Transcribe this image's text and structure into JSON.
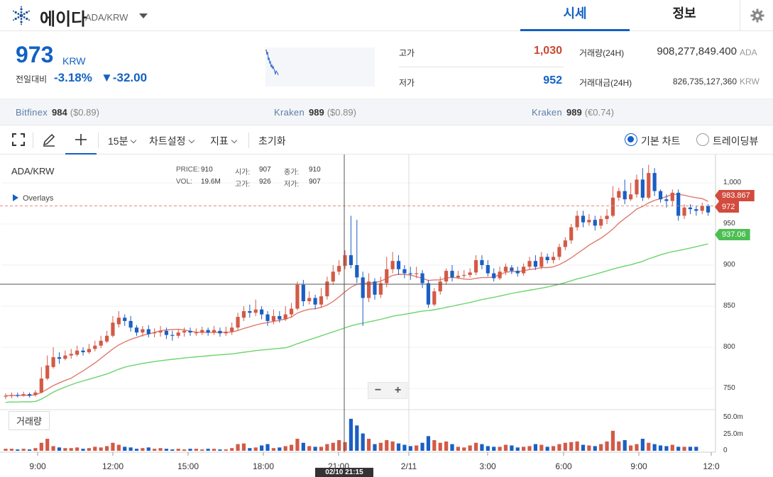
{
  "header": {
    "coin_name": "에이다",
    "coin_pair": "ADA/KRW",
    "tab_market": "시세",
    "tab_info": "정보"
  },
  "price": {
    "current": "973",
    "unit": "KRW",
    "change_label": "전일대비",
    "change_pct": "-3.18%",
    "change_abs": "▼-32.00"
  },
  "stats": {
    "high_label": "고가",
    "high_value": "1,030",
    "low_label": "저가",
    "low_value": "952",
    "volume_label": "거래량(24H)",
    "volume_value": "908,277,849.400",
    "volume_unit": "ADA",
    "amount_label": "거래대금(24H)",
    "amount_value": "826,735,127,360",
    "amount_unit": "KRW"
  },
  "exchanges": [
    {
      "name": "Bitfinex",
      "price": "984",
      "fx": "($0.89)"
    },
    {
      "name": "Kraken",
      "price": "989",
      "fx": "($0.89)"
    },
    {
      "name": "Kraken",
      "price": "989",
      "fx": "(€0.74)"
    }
  ],
  "toolbar": {
    "interval": "15분",
    "chart_settings": "차트설정",
    "indicators": "지표",
    "reset": "초기화",
    "basic_chart": "기본 차트",
    "tradingview": "트레이딩뷰"
  },
  "chart_overlay": {
    "pair": "ADA/KRW",
    "price_k": "PRICE:",
    "price_v": "910",
    "open_k": "시가:",
    "open_v": "907",
    "close_k": "종가:",
    "close_v": "910",
    "vol_k": "VOL:",
    "vol_v": "19.6M",
    "high_k": "고가:",
    "high_v": "926",
    "low_k": "저가:",
    "low_v": "907",
    "overlays": "Overlays",
    "zoom_out": "−",
    "zoom_in": "+",
    "volume_tab": "거래량",
    "crosshair_time": "02/10 21:15"
  },
  "colors": {
    "up": "#d35a46",
    "down": "#1a5fc4",
    "ma_short": "#e07a6c",
    "ma_long": "#6cd46c",
    "accent": "#1261c4"
  },
  "chart_data": {
    "type": "candlestick",
    "y_ticks": [
      "1,000",
      "950",
      "900",
      "850",
      "800",
      "750"
    ],
    "y_tick_values": [
      1000,
      950,
      900,
      850,
      800,
      750
    ],
    "vol_ticks": [
      "50.0m",
      "25.0m",
      "0"
    ],
    "vol_tick_values": [
      50,
      25,
      0
    ],
    "x_ticks": [
      "9:00",
      "12:00",
      "15:00",
      "18:00",
      "21:00",
      "2/11",
      "3:00",
      "6:00",
      "9:00",
      "12:0"
    ],
    "price_tags": [
      {
        "label": "983.867",
        "value": 983.867,
        "color": "#d24b3e"
      },
      {
        "label": "972",
        "value": 972,
        "color": "#d24b3e"
      },
      {
        "label": "937.06",
        "value": 937.06,
        "color": "#4cbf52"
      }
    ],
    "ylim": [
      730,
      1030
    ],
    "candles": [
      [
        740,
        741,
        737,
        744
      ],
      [
        741,
        742,
        738,
        745
      ],
      [
        742,
        741,
        739,
        745
      ],
      [
        741,
        743,
        740,
        746
      ],
      [
        743,
        741,
        739,
        745
      ],
      [
        742,
        745,
        740,
        748
      ],
      [
        745,
        762,
        744,
        776
      ],
      [
        762,
        778,
        760,
        790
      ],
      [
        776,
        788,
        774,
        800
      ],
      [
        788,
        786,
        780,
        794
      ],
      [
        786,
        790,
        784,
        796
      ],
      [
        790,
        792,
        786,
        798
      ],
      [
        791,
        796,
        789,
        802
      ],
      [
        796,
        794,
        790,
        800
      ],
      [
        794,
        798,
        792,
        804
      ],
      [
        798,
        802,
        795,
        808
      ],
      [
        802,
        808,
        799,
        814
      ],
      [
        807,
        814,
        805,
        820
      ],
      [
        814,
        830,
        812,
        838
      ],
      [
        828,
        836,
        824,
        844
      ],
      [
        836,
        832,
        826,
        840
      ],
      [
        832,
        824,
        819,
        838
      ],
      [
        824,
        818,
        814,
        827
      ],
      [
        818,
        822,
        813,
        826
      ],
      [
        822,
        816,
        812,
        827
      ],
      [
        817,
        818,
        812,
        823
      ],
      [
        818,
        820,
        813,
        826
      ],
      [
        820,
        815,
        810,
        824
      ],
      [
        815,
        814,
        808,
        820
      ],
      [
        814,
        818,
        811,
        822
      ],
      [
        818,
        820,
        813,
        824
      ],
      [
        820,
        818,
        814,
        824
      ],
      [
        818,
        818,
        814,
        823
      ],
      [
        818,
        821,
        815,
        825
      ],
      [
        821,
        818,
        814,
        824
      ],
      [
        818,
        821,
        815,
        826
      ],
      [
        820,
        817,
        813,
        824
      ],
      [
        817,
        819,
        814,
        825
      ],
      [
        819,
        824,
        815,
        830
      ],
      [
        824,
        837,
        821,
        842
      ],
      [
        836,
        844,
        832,
        850
      ],
      [
        844,
        842,
        836,
        852
      ],
      [
        842,
        846,
        838,
        858
      ],
      [
        846,
        840,
        834,
        850
      ],
      [
        840,
        832,
        826,
        844
      ],
      [
        832,
        838,
        828,
        846
      ],
      [
        838,
        834,
        830,
        844
      ],
      [
        834,
        840,
        832,
        850
      ],
      [
        840,
        847,
        836,
        854
      ],
      [
        847,
        876,
        845,
        880
      ],
      [
        876,
        856,
        850,
        882
      ],
      [
        856,
        860,
        852,
        868
      ],
      [
        860,
        852,
        846,
        864
      ],
      [
        852,
        862,
        848,
        872
      ],
      [
        862,
        880,
        858,
        886
      ],
      [
        880,
        892,
        876,
        900
      ],
      [
        892,
        899,
        888,
        906
      ],
      [
        899,
        912,
        895,
        918
      ],
      [
        912,
        900,
        896,
        960
      ],
      [
        900,
        885,
        878,
        955
      ],
      [
        885,
        860,
        826,
        892
      ],
      [
        860,
        880,
        855,
        890
      ],
      [
        880,
        864,
        858,
        884
      ],
      [
        864,
        878,
        860,
        886
      ],
      [
        878,
        895,
        873,
        910
      ],
      [
        895,
        905,
        890,
        916
      ],
      [
        905,
        895,
        888,
        912
      ],
      [
        895,
        890,
        884,
        900
      ],
      [
        890,
        889,
        882,
        898
      ],
      [
        889,
        890,
        884,
        898
      ],
      [
        890,
        878,
        872,
        894
      ],
      [
        878,
        852,
        848,
        882
      ],
      [
        852,
        868,
        850,
        872
      ],
      [
        868,
        880,
        864,
        886
      ],
      [
        880,
        893,
        876,
        896
      ],
      [
        893,
        885,
        880,
        900
      ],
      [
        885,
        887,
        883,
        893
      ],
      [
        887,
        888,
        884,
        894
      ],
      [
        888,
        891,
        885,
        896
      ],
      [
        891,
        906,
        888,
        912
      ],
      [
        906,
        900,
        895,
        912
      ],
      [
        900,
        890,
        886,
        906
      ],
      [
        890,
        884,
        880,
        896
      ],
      [
        884,
        892,
        882,
        898
      ],
      [
        892,
        898,
        888,
        902
      ],
      [
        897,
        893,
        889,
        900
      ],
      [
        893,
        890,
        886,
        898
      ],
      [
        890,
        898,
        887,
        902
      ],
      [
        898,
        905,
        894,
        910
      ],
      [
        905,
        898,
        894,
        912
      ],
      [
        898,
        910,
        895,
        916
      ],
      [
        910,
        906,
        902,
        914
      ],
      [
        906,
        910,
        902,
        916
      ],
      [
        910,
        922,
        906,
        926
      ],
      [
        922,
        930,
        918,
        934
      ],
      [
        930,
        946,
        926,
        950
      ],
      [
        946,
        960,
        942,
        966
      ],
      [
        960,
        952,
        946,
        966
      ],
      [
        952,
        955,
        948,
        962
      ],
      [
        955,
        948,
        942,
        960
      ],
      [
        948,
        956,
        944,
        960
      ],
      [
        956,
        960,
        950,
        968
      ],
      [
        960,
        982,
        958,
        996
      ],
      [
        982,
        990,
        978,
        994
      ],
      [
        990,
        980,
        974,
        1004
      ],
      [
        980,
        986,
        978,
        1000
      ],
      [
        986,
        1004,
        982,
        1010
      ],
      [
        1004,
        982,
        978,
        1018
      ],
      [
        982,
        1012,
        980,
        1022
      ],
      [
        1012,
        990,
        984,
        1018
      ],
      [
        990,
        980,
        976,
        992
      ],
      [
        980,
        978,
        970,
        986
      ],
      [
        978,
        988,
        972,
        992
      ],
      [
        988,
        960,
        954,
        992
      ],
      [
        960,
        970,
        956,
        974
      ],
      [
        970,
        968,
        962,
        974
      ],
      [
        968,
        966,
        960,
        972
      ],
      [
        966,
        972,
        962,
        976
      ],
      [
        972,
        964,
        960,
        974
      ]
    ],
    "volumes": [
      3,
      3,
      2,
      3,
      2,
      4,
      12,
      18,
      7,
      5,
      4,
      4,
      5,
      3,
      4,
      6,
      5,
      7,
      12,
      9,
      6,
      5,
      3,
      4,
      5,
      3,
      4,
      3,
      2,
      3,
      2,
      3,
      3,
      2,
      3,
      3,
      2,
      2,
      4,
      10,
      11,
      4,
      5,
      8,
      10,
      4,
      5,
      7,
      9,
      18,
      12,
      7,
      6,
      6,
      10,
      12,
      16,
      13,
      48,
      38,
      26,
      18,
      10,
      12,
      16,
      14,
      11,
      9,
      7,
      8,
      12,
      22,
      16,
      12,
      14,
      10,
      6,
      5,
      8,
      12,
      10,
      7,
      6,
      6,
      9,
      8,
      5,
      6,
      7,
      10,
      9,
      6,
      7,
      10,
      12,
      13,
      14,
      9,
      8,
      7,
      10,
      14,
      30,
      14,
      16,
      8,
      10,
      18,
      12,
      10,
      8,
      7,
      9,
      6,
      6,
      6,
      6
    ]
  }
}
